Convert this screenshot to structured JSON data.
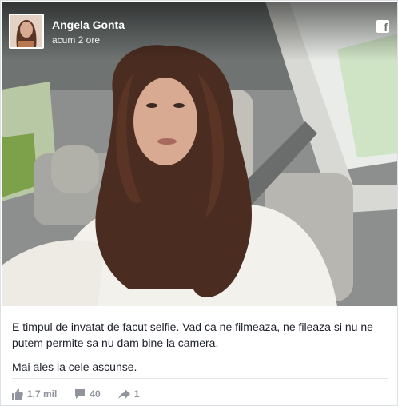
{
  "post": {
    "author": "Angela Gonta",
    "timestamp": "acum 2 ore",
    "platform_icon": "facebook-icon",
    "caption_line1": "E timpul de invatat de facut selfie. Vad ca ne filmeaza, ne fileaza si nu ne putem permite sa nu dam bine la camera.",
    "caption_line2": "Mai ales la cele ascunse."
  },
  "stats": {
    "likes": "1,7 mil",
    "comments": "40",
    "shares": "1"
  },
  "icons": {
    "like": "thumbs-up-icon",
    "comment": "comment-icon",
    "share": "share-arrow-icon"
  }
}
